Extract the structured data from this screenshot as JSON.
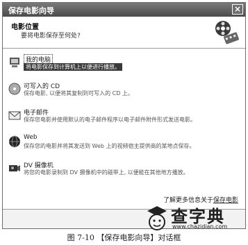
{
  "window": {
    "title": "保存电影向导",
    "close_glyph": "×"
  },
  "header": {
    "title": "电影位置",
    "subtitle": "要将电影保存至何处?",
    "icon": "film-reel-icon"
  },
  "options": [
    {
      "label": "我的电脑",
      "description": "将电影保存到计算机上以便进行播放。",
      "icon": "computer-icon",
      "selected": true
    },
    {
      "label": "可写入的 CD",
      "description": "保存电影, 以便将其复制到可写入的 CD 上。",
      "icon": "cd-icon",
      "selected": false
    },
    {
      "label": "电子邮件",
      "description": "保存您电影并使用默认的电子邮件程序以电子邮件附件形式发送电影。",
      "icon": "email-icon",
      "selected": false
    },
    {
      "label": "Web",
      "description": "保存您的电影并将其发送到 Web 上的视频宿主提供商的某地点保存。",
      "icon": "web-globe-icon",
      "selected": false
    },
    {
      "label": "DV 摄像机",
      "description": "将您的电影录制到 DV 摄像机中的磁带上, 以便能在其他地方播放。",
      "icon": "dv-camera-icon",
      "selected": false
    }
  ],
  "more_info": {
    "prefix": "了解更多信息关于",
    "link": "保存电影"
  },
  "caption": "图 7-10 【保存电影向导】对话框",
  "watermark": {
    "text": "查字典",
    "url": "www.chazidian.com"
  }
}
